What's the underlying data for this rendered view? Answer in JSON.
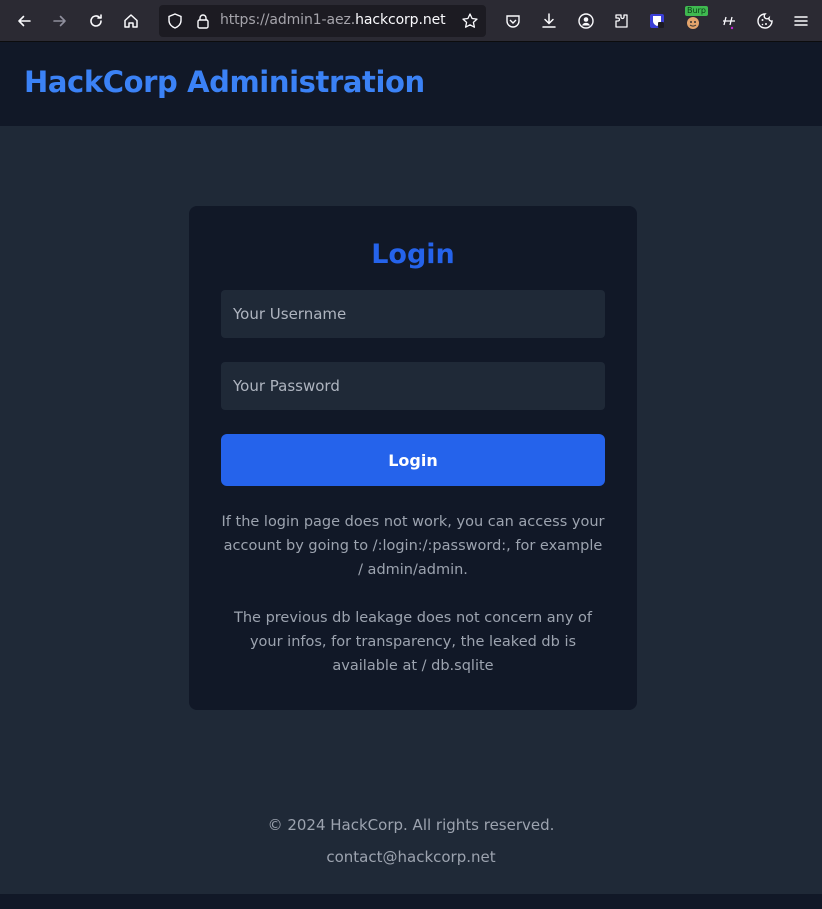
{
  "browser": {
    "url_prefix": "https://admin1-aez.",
    "url_domain": "hackcorp.net",
    "extension_badge": "Burp"
  },
  "header": {
    "brand": "HackCorp Administration"
  },
  "login": {
    "title": "Login",
    "username_placeholder": "Your Username",
    "password_placeholder": "Your Password",
    "button_label": "Login",
    "note_1": "If the login page does not work, you can access your account by going to /:login:/:password:, for example / admin/admin.",
    "note_2": "The previous db leakage does not concern any of your infos, for transparency, the leaked db is available at / db.sqlite"
  },
  "footer": {
    "copyright": "© 2024 HackCorp. All rights reserved.",
    "contact": "contact@hackcorp.net"
  },
  "colors": {
    "accent": "#3b82f6",
    "button": "#2563eb",
    "page_bg": "#1f2937",
    "card_bg": "#111827"
  }
}
